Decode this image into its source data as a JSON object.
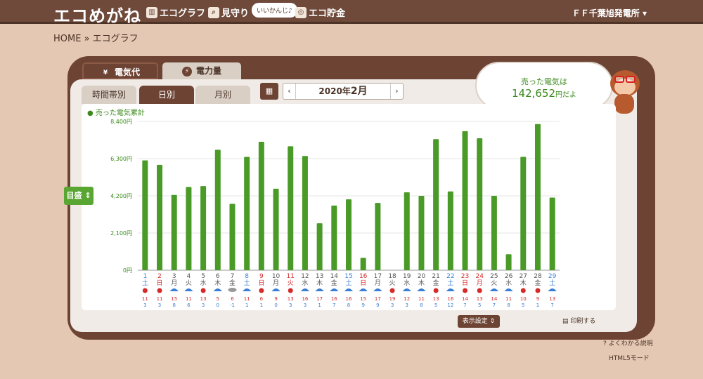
{
  "header": {
    "logo": "エコめがね",
    "nav": [
      {
        "label": "エコグラフ",
        "icon": "graph-icon"
      },
      {
        "label": "見守り",
        "icon": "magnifier-icon"
      },
      {
        "label": "エコ貯金",
        "icon": "coin-icon"
      }
    ],
    "bubble": "いいかんじ♪",
    "office": "ＦＦ千葉旭発電所"
  },
  "breadcrumb": "HOME » エコグラフ",
  "tabs": [
    {
      "label": "電気代",
      "icon": "yen-icon",
      "active": true
    },
    {
      "label": "電力量",
      "icon": "bolt-icon",
      "active": false
    }
  ],
  "subtabs": [
    {
      "label": "時間帯別",
      "active": false
    },
    {
      "label": "日別",
      "active": true
    },
    {
      "label": "月別",
      "active": false
    }
  ],
  "date": {
    "prev": "‹",
    "year": "2020年",
    "month": "2月",
    "next": "›"
  },
  "summary": {
    "line1": "売った電気は",
    "amount": "142,652",
    "suffix": "円だよ"
  },
  "side_button": "目盛",
  "legend": "売った電気累計",
  "chart_data": {
    "type": "bar",
    "ylim": [
      0,
      8400
    ],
    "yticks": [
      "8,400円",
      "6,300円",
      "4,200円",
      "2,100円",
      "0円"
    ],
    "days": [
      "1",
      "2",
      "3",
      "4",
      "5",
      "6",
      "7",
      "8",
      "9",
      "10",
      "11",
      "12",
      "13",
      "14",
      "15",
      "16",
      "17",
      "18",
      "19",
      "20",
      "21",
      "22",
      "23",
      "24",
      "25",
      "26",
      "27",
      "28",
      "29"
    ],
    "weekdays": [
      "土",
      "日",
      "月",
      "火",
      "水",
      "木",
      "金",
      "土",
      "日",
      "月",
      "火",
      "水",
      "木",
      "金",
      "土",
      "日",
      "月",
      "火",
      "水",
      "木",
      "金",
      "土",
      "日",
      "月",
      "火",
      "水",
      "木",
      "金",
      "土"
    ],
    "values": [
      6200,
      5950,
      4250,
      4700,
      4750,
      6800,
      3750,
      6400,
      7250,
      4600,
      7000,
      6450,
      2650,
      3650,
      4000,
      700,
      3800,
      0,
      4400,
      4200,
      7400,
      4450,
      7850,
      7450,
      4200,
      900,
      6400,
      8250,
      4100
    ],
    "day_colors": [
      "blue",
      "red",
      "normal",
      "normal",
      "normal",
      "normal",
      "normal",
      "blue",
      "red",
      "normal",
      "red",
      "normal",
      "normal",
      "normal",
      "blue",
      "red",
      "normal",
      "normal",
      "normal",
      "normal",
      "normal",
      "blue",
      "red",
      "red",
      "normal",
      "normal",
      "normal",
      "normal",
      "blue"
    ],
    "weather": [
      "sun",
      "sun",
      "rain",
      "rain",
      "sun",
      "rain",
      "cloud",
      "rain",
      "sun",
      "rain",
      "sun",
      "rain",
      "rain",
      "rain",
      "rain",
      "rain",
      "rain",
      "sun",
      "rain",
      "rain",
      "sun",
      "rain",
      "sun",
      "sun",
      "rain",
      "rain",
      "sun",
      "sun",
      "rain"
    ],
    "high": [
      "11",
      "11",
      "15",
      "11",
      "13",
      "5",
      "6",
      "11",
      "6",
      "9",
      "13",
      "16",
      "17",
      "16",
      "16",
      "15",
      "17",
      "19",
      "12",
      "11",
      "13",
      "16",
      "14",
      "13",
      "14",
      "11",
      "10",
      "9",
      "13"
    ],
    "low": [
      "3",
      "3",
      "8",
      "6",
      "3",
      "0",
      "-1",
      "1",
      "1",
      "0",
      "3",
      "3",
      "1",
      "7",
      "8",
      "9",
      "9",
      "3",
      "3",
      "8",
      "5",
      "12",
      "7",
      "5",
      "7",
      "8",
      "5",
      "1",
      "7"
    ],
    "bar_color": "#4a9a28"
  },
  "controls": {
    "display": "表示設定",
    "print": "印刷する",
    "help": "よくわかる説明",
    "html5": "HTML5モード"
  }
}
